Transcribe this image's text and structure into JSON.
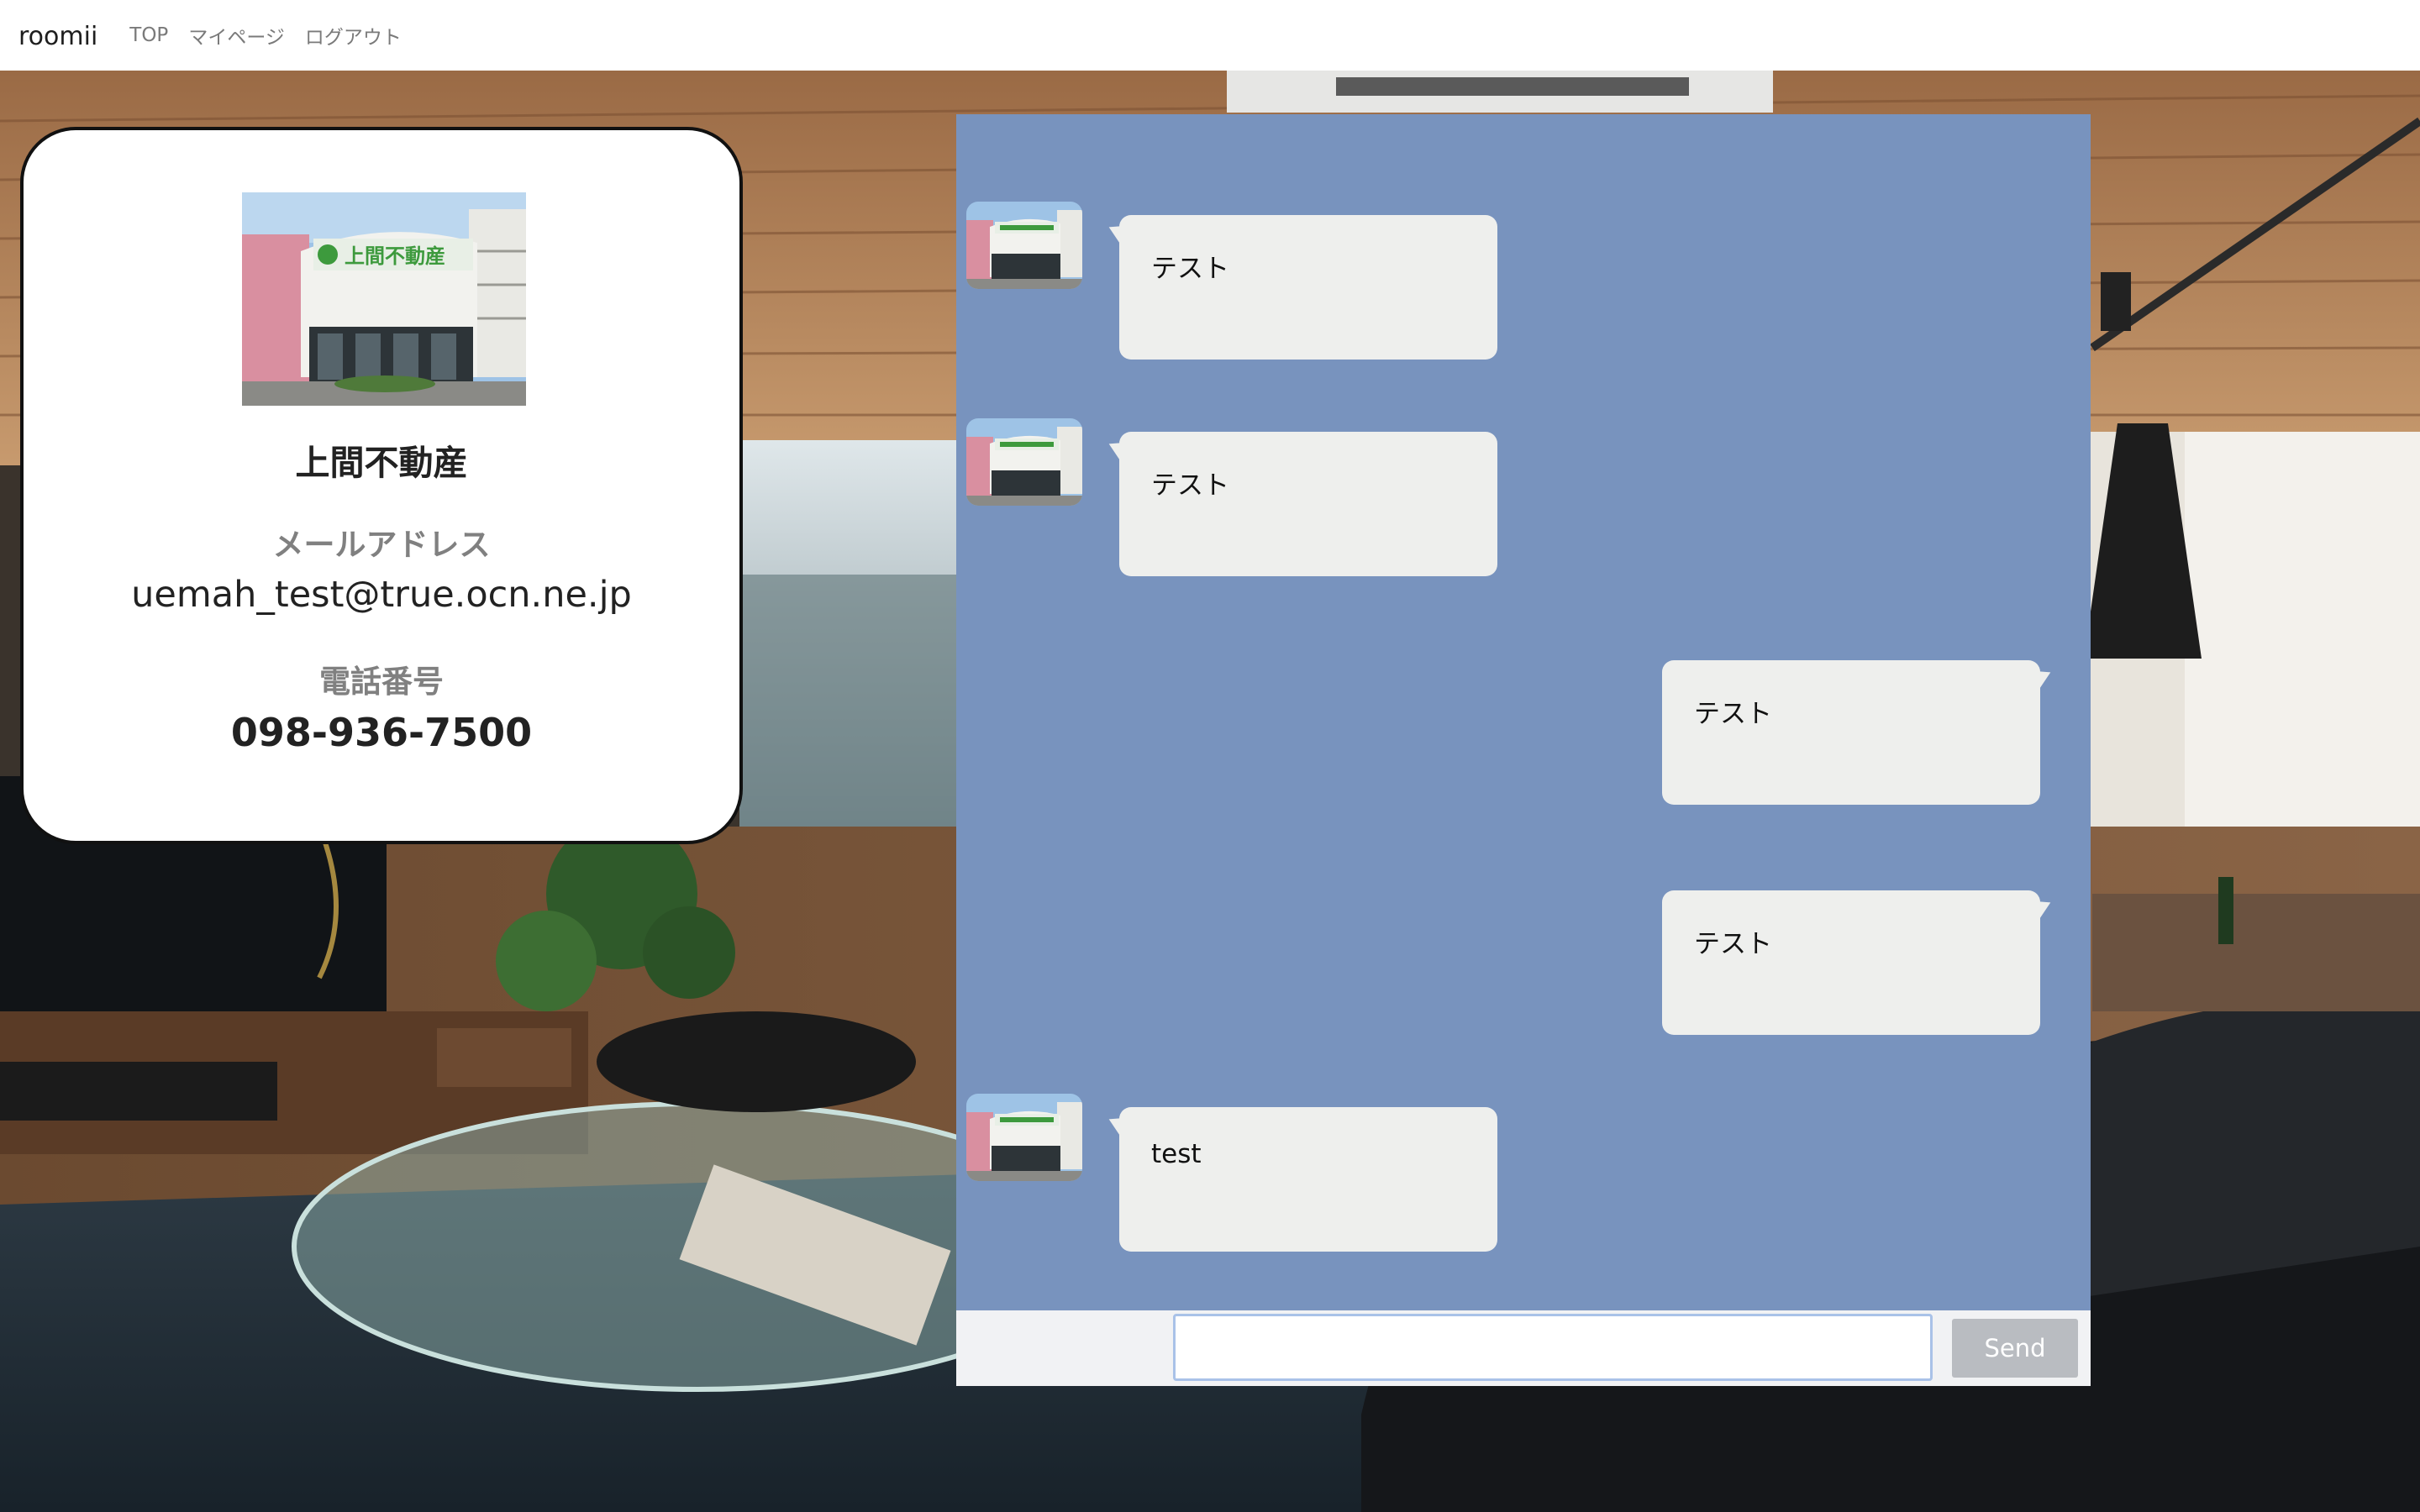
{
  "navbar": {
    "brand": "roomii",
    "links": [
      "TOP",
      "マイページ",
      "ログアウト"
    ]
  },
  "profile": {
    "company_name": "上間不動産",
    "email_label": "メールアドレス",
    "email": "uemah_test@true.ocn.ne.jp",
    "phone_label": "電話番号",
    "phone": "098-936-7500",
    "photo_sign_text": "上間不動産"
  },
  "chat": {
    "messages": [
      {
        "side": "left",
        "text": "テスト",
        "has_avatar": true
      },
      {
        "side": "left",
        "text": "テスト",
        "has_avatar": true
      },
      {
        "side": "right",
        "text": "テスト",
        "has_avatar": false
      },
      {
        "side": "right",
        "text": "テスト",
        "has_avatar": false
      },
      {
        "side": "left",
        "text": "test",
        "has_avatar": true
      }
    ],
    "input_value": "",
    "send_label": "Send"
  },
  "colors": {
    "chat_background": "#7893be",
    "bubble": "#eeefed",
    "send_button": "#b9bcc1",
    "input_focus_border": "#a9c2e8"
  }
}
